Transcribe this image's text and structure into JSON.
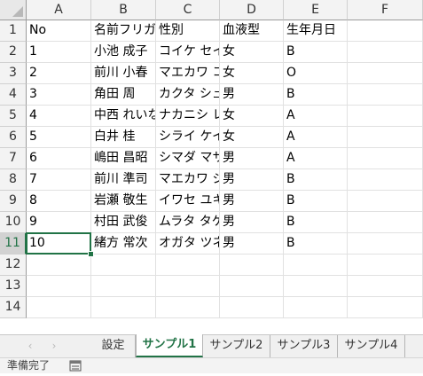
{
  "columns": [
    "A",
    "B",
    "C",
    "D",
    "E",
    "F"
  ],
  "rows": [
    {
      "num": "1",
      "a": "No",
      "b": "名前フリガナ",
      "c": "性別",
      "d": "血液型",
      "e": "生年月日",
      "flag": false
    },
    {
      "num": "2",
      "a": "1",
      "b": "小池 成子",
      "c": "コイケ セイコ",
      "d": "女",
      "e": "B",
      "flag": true
    },
    {
      "num": "3",
      "a": "2",
      "b": "前川 小春",
      "c": "マエカワ コハル",
      "d": "女",
      "e": "O",
      "flag": true
    },
    {
      "num": "4",
      "a": "3",
      "b": "角田 周",
      "c": "カクタ シュウ",
      "d": "男",
      "e": "B",
      "flag": true
    },
    {
      "num": "5",
      "a": "4",
      "b": "中西 れいな",
      "c": "ナカニシ レイナ",
      "d": "女",
      "e": "A",
      "flag": true
    },
    {
      "num": "6",
      "a": "5",
      "b": "白井 桂",
      "c": "シライ ケイ",
      "d": "女",
      "e": "A",
      "flag": true
    },
    {
      "num": "7",
      "a": "6",
      "b": "嶋田 昌昭",
      "c": "シマダ マサアキ",
      "d": "男",
      "e": "A",
      "flag": true
    },
    {
      "num": "8",
      "a": "7",
      "b": "前川 準司",
      "c": "マエカワ ジュンジ",
      "d": "男",
      "e": "B",
      "flag": true
    },
    {
      "num": "9",
      "a": "8",
      "b": "岩瀬 敬生",
      "c": "イワセ ユキオ",
      "d": "男",
      "e": "B",
      "flag": true
    },
    {
      "num": "10",
      "a": "9",
      "b": "村田 武俊",
      "c": "ムラタ タケトシ",
      "d": "男",
      "e": "B",
      "flag": true
    },
    {
      "num": "11",
      "a": "10",
      "b": "緒方 常次",
      "c": "オガタ ツネジ",
      "d": "男",
      "e": "B",
      "flag": true
    },
    {
      "num": "12",
      "a": "",
      "b": "",
      "c": "",
      "d": "",
      "e": "",
      "flag": false
    },
    {
      "num": "13",
      "a": "",
      "b": "",
      "c": "",
      "d": "",
      "e": "",
      "flag": false
    },
    {
      "num": "14",
      "a": "",
      "b": "",
      "c": "",
      "d": "",
      "e": "",
      "flag": false
    }
  ],
  "tabs": [
    {
      "label": "設定",
      "active": false
    },
    {
      "label": "サンプル1",
      "active": true
    },
    {
      "label": "サンプル2",
      "active": false
    },
    {
      "label": "サンプル3",
      "active": false
    },
    {
      "label": "サンプル4",
      "active": false
    }
  ],
  "nav": {
    "prev_icon": "‹",
    "next_icon": "›"
  },
  "status": {
    "ready": "準備完了",
    "icon": "macro-record-icon"
  },
  "colors": {
    "accent": "#217346",
    "flag": "#1d7d3e"
  }
}
